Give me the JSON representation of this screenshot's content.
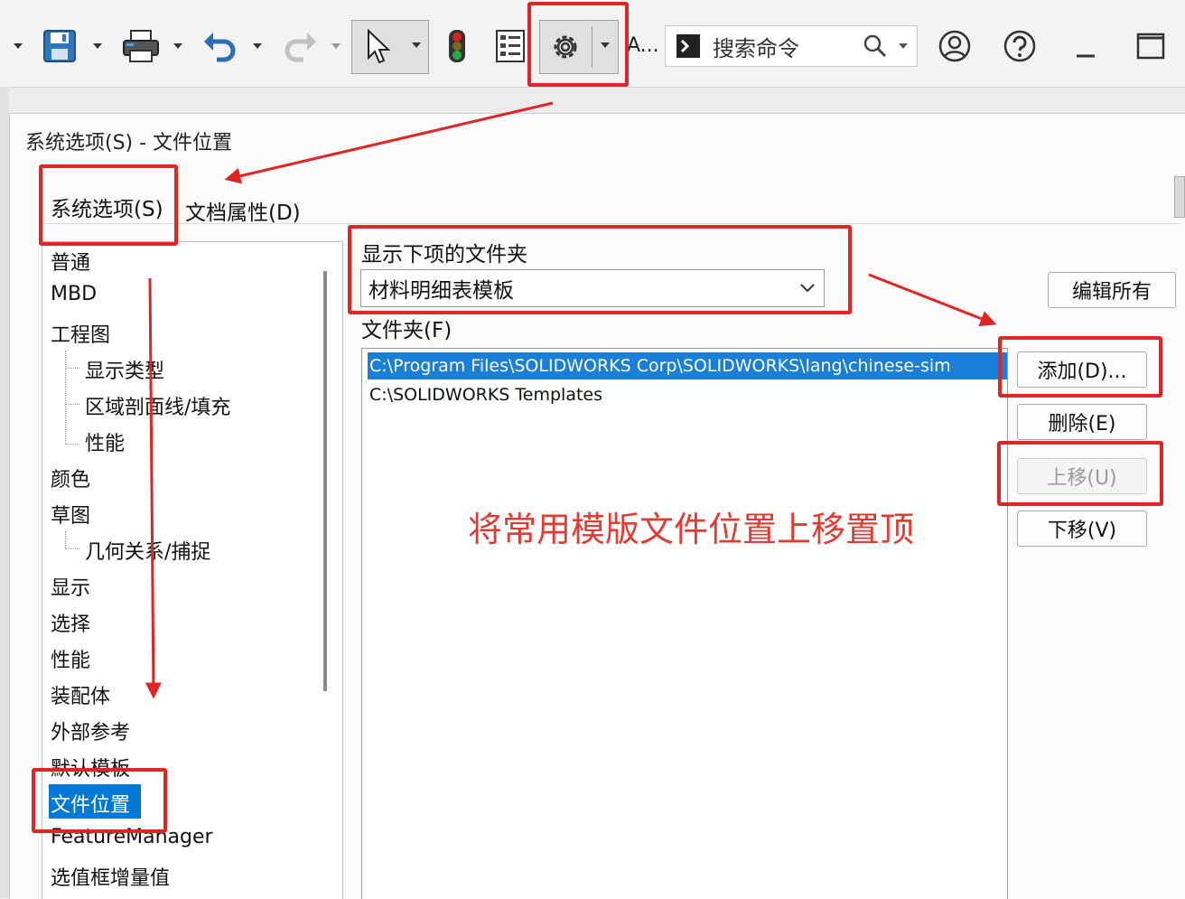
{
  "toolbar": {
    "truncated_label": "A...",
    "search_placeholder": "搜索命令"
  },
  "dialog": {
    "title": "系统选项(S) - 文件位置",
    "tabs": [
      {
        "label": "系统选项(S)",
        "active": true
      },
      {
        "label": "文档属性(D)",
        "active": false
      }
    ]
  },
  "tree": {
    "items": [
      {
        "label": "普通",
        "level": 0
      },
      {
        "label": "MBD",
        "level": 0
      },
      {
        "label": "工程图",
        "level": 0
      },
      {
        "label": "显示类型",
        "level": 1
      },
      {
        "label": "区域剖面线/填充",
        "level": 1
      },
      {
        "label": "性能",
        "level": 1
      },
      {
        "label": "颜色",
        "level": 0
      },
      {
        "label": "草图",
        "level": 0
      },
      {
        "label": "几何关系/捕捉",
        "level": 1
      },
      {
        "label": "显示",
        "level": 0
      },
      {
        "label": "选择",
        "level": 0
      },
      {
        "label": "性能",
        "level": 0
      },
      {
        "label": "装配体",
        "level": 0
      },
      {
        "label": "外部参考",
        "level": 0
      },
      {
        "label": "默认模板",
        "level": 0
      },
      {
        "label": "文件位置",
        "level": 0,
        "selected": true
      },
      {
        "label": "FeatureManager",
        "level": 0
      },
      {
        "label": "选值框增量值",
        "level": 0
      }
    ]
  },
  "main": {
    "show_label": "显示下项的文件夹",
    "selected_folder": "材料明细表模板",
    "folders_label": "文件夹(F)",
    "folders": [
      {
        "path": "C:\\Program Files\\SOLIDWORKS Corp\\SOLIDWORKS\\lang\\chinese-sim",
        "selected": true
      },
      {
        "path": "C:\\SOLIDWORKS Templates",
        "selected": false
      }
    ]
  },
  "buttons": {
    "edit_all": "编辑所有",
    "add": "添加(D)...",
    "delete": "删除(E)",
    "move_up": "上移(U)",
    "move_down": "下移(V)"
  },
  "annotation": {
    "text": "将常用模版文件位置上移置顶",
    "color": "#e33b32"
  },
  "colors": {
    "highlight": "#e12424",
    "selection": "#0078d7"
  }
}
